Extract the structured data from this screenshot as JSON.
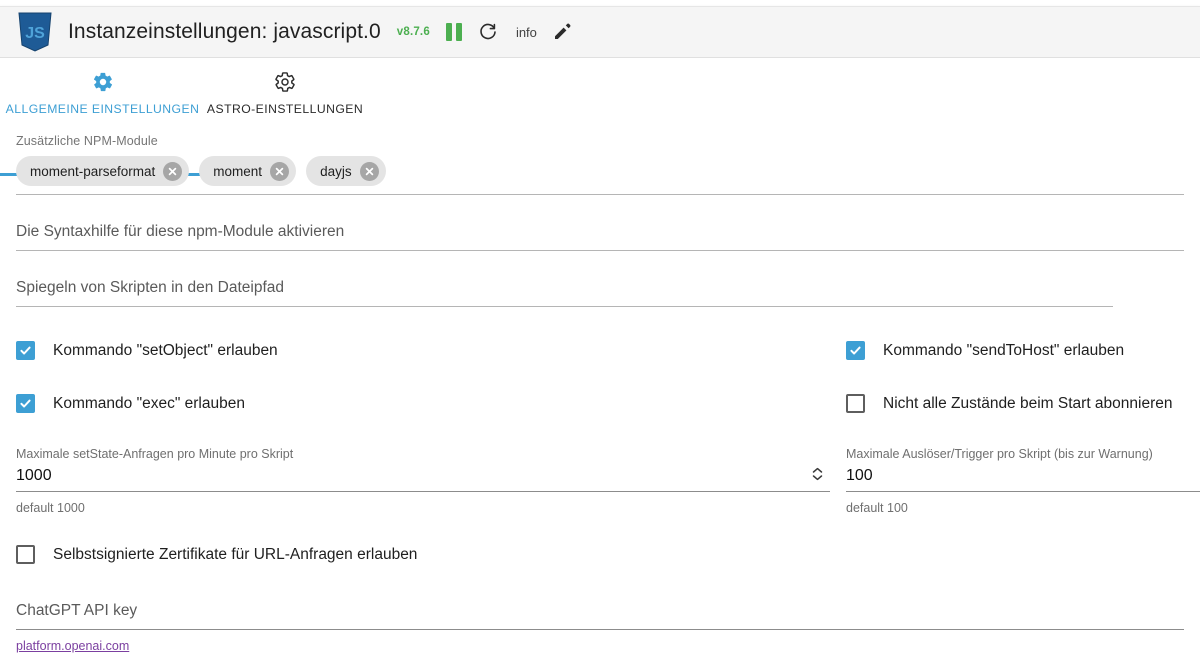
{
  "header": {
    "logo_icon": "javascript-shield-icon",
    "title": "Instanzeinstellungen: javascript.0",
    "version": "v8.7.6",
    "pause_icon": "pause-icon",
    "refresh_icon": "refresh-icon",
    "info_label": "info",
    "edit_icon": "pencil-edit-icon",
    "accent_green": "#4caf50",
    "background": "#f5f5f5"
  },
  "tabs": {
    "accent": "#3d9fd4",
    "items": [
      {
        "label": "ALLGEMEINE EINSTELLUNGEN",
        "icon": "gear-filled-icon",
        "active": true
      },
      {
        "label": "ASTRO-EINSTELLUNGEN",
        "icon": "gear-outline-icon",
        "active": false
      }
    ]
  },
  "npm_modules": {
    "label": "Zusätzliche NPM-Module",
    "chips": [
      {
        "name": "moment-parseformat",
        "remove_icon": "close-circle-icon"
      },
      {
        "name": "moment",
        "remove_icon": "close-circle-icon"
      },
      {
        "name": "dayjs",
        "remove_icon": "close-circle-icon"
      }
    ]
  },
  "syntax_help": {
    "placeholder": "Die Syntaxhilfe für diese npm-Module aktivieren",
    "value": ""
  },
  "mirror_path": {
    "placeholder": "Spiegeln von Skripten in den Dateipfad",
    "value": ""
  },
  "checkboxes": [
    {
      "label": "Kommando \"setObject\" erlauben",
      "checked": true
    },
    {
      "label": "Kommando \"sendToHost\" erlauben",
      "checked": true
    },
    {
      "label": "Kommando \"exec\" erlauben",
      "checked": true
    },
    {
      "label": "Nicht alle Zustände beim Start abonnieren",
      "checked": false
    }
  ],
  "numbers": {
    "setstate": {
      "label": "Maximale setState-Anfragen pro Minute pro Skript",
      "value": "1000",
      "help": "default 1000",
      "stepper_icon": "stepper-updown-icon"
    },
    "triggers": {
      "label": "Maximale Auslöser/Trigger pro Skript (bis zur Warnung)",
      "value": "100",
      "help": "default 100"
    }
  },
  "self_signed": {
    "label": "Selbstsignierte Zertifikate für URL-Anfragen erlauben",
    "checked": false
  },
  "chatgpt": {
    "placeholder": "ChatGPT API key",
    "value": "",
    "link_text": "platform.openai.com",
    "link_color": "#7b3fa0"
  }
}
